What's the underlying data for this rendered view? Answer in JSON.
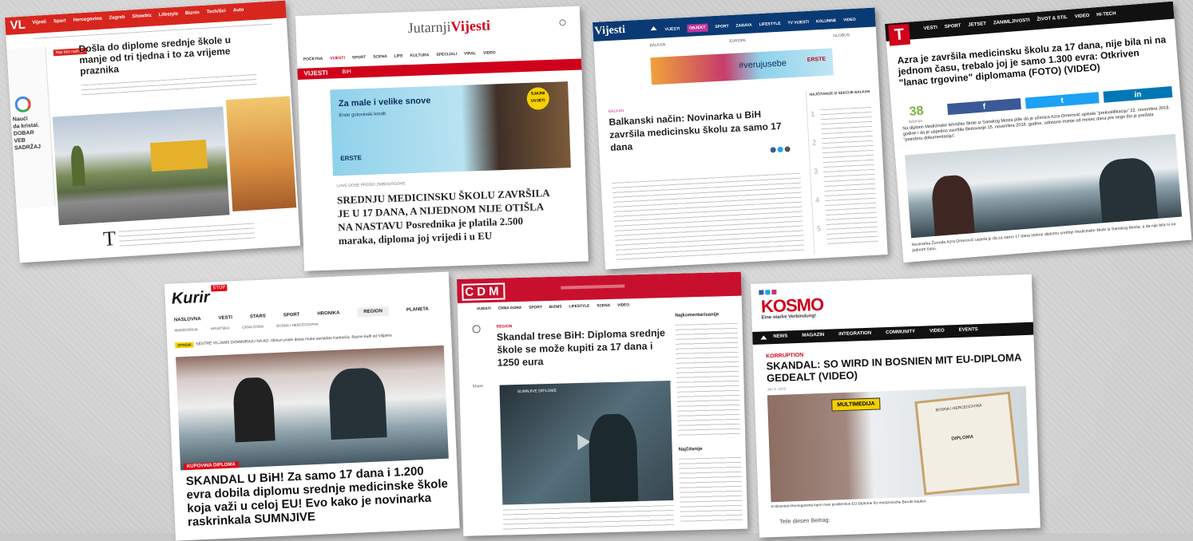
{
  "colors": {
    "vl_red": "#d7261e",
    "jutarnji_red": "#d0021b",
    "vijesti_blue": "#0a3a74",
    "telegraf_red": "#d0021b",
    "kurir_red": "#e30613",
    "cdm_red": "#c8102e",
    "kosmo_red": "#d0021b"
  },
  "vl": {
    "logo": "VL",
    "nav": [
      "Vijesti",
      "Sport",
      "Hercegovina",
      "Zagreb",
      "Showbiz",
      "Lifestyle",
      "Biznis",
      "Tech/Sci",
      "Auto"
    ],
    "tag": "Nije bez razloga",
    "headline": "Došla do diplome srednje škole u manje od tri tjedna i to za vrijeme praznika",
    "ad_lines": [
      "Naući",
      "da kristal.",
      "DOBAR",
      "VEB",
      "SADRŽAJ"
    ],
    "drop": "T"
  },
  "jutarnji": {
    "logo_a": "Jutarnji",
    "logo_b": "Vijesti",
    "nav": [
      "POČETNA",
      "VIJESTI",
      "SPORT",
      "SCENA",
      "LIFE",
      "KULTURA",
      "SPECIJALI",
      "VIRAL",
      "VIDEO"
    ],
    "section": "VIJESTI",
    "sub": "BiH",
    "ad_title": "Za male i velike snove",
    "ad_text": "Erste gotovinski kredit",
    "ad_brand": "ERSTE",
    "ad_badge": "SJAJNI UVJETI",
    "kicker": "LOVE DOSE PRODO ZMBOURGOVE",
    "headline": "SREDNJU MEDICINSKU ŠKOLU ZAVRŠILA JE U 17 DANA, A NIJEDNOM NIJE OTIŠLA NA NASTAVU Posrednika je platila 2.500 maraka, diploma joj vrijedi i u EU"
  },
  "vijesti": {
    "logo": "Vijesti",
    "nav": [
      "VIJESTI",
      "OBJEKT",
      "SPORT",
      "ZABAVA",
      "LIFESTYLE",
      "TV VIJESTI",
      "KOLUMNE",
      "VIDEO"
    ],
    "sub_left": "BALKAN",
    "sub_mid": "EVROPA",
    "sub_right": "GLOBUS",
    "ad": "#verujusebe",
    "ad_brand": "ERSTE",
    "kicker": "BALKAN",
    "headline": "Balkanski način: Novinarka u BiH završila medicinsku školu za samo 17 dana",
    "side_title": "NAJČITANIJE IZ SEKCIJE BALKAN",
    "side_nums": [
      "1",
      "2",
      "3",
      "4",
      "5"
    ]
  },
  "telegraf": {
    "logo": "T",
    "nav": [
      "VESTI",
      "SPORT",
      "JETSET",
      "ZANIMLJIVOSTI",
      "ŽIVOT & STIL",
      "VIDEO",
      "HI-TECH"
    ],
    "headline": "Azra je završila medicinsku školu za 17 dana, nije bila ni na jednom času, trebalo joj je samo 1.300 evra: Otkriven \"lanac trgovine\" diplomama (FOTO) (VIDEO)",
    "share_count": "38",
    "share_label": "deljenja",
    "fb": "f",
    "tw": "t",
    "li": "in",
    "body": "Na diplomi Medicinske tehničke škole iz Sanskog Mosta piše da je učenica Azra Omerović upisala \"prekvalifikaciju\" 22. novembra 2018. godine i da je uspešno završila školovanje 15. novembra 2018. godine, odnosno manje od mesec dana pre nego što je predata \"potrebnu dokumentaciju\".",
    "caption": "Novinarka Žurnala Azra Omerović uspela je da za samo 17 dana stekne diplomu srednje medicinske škole iz Sanskog Mosta, a da nije bila ni na jednom času."
  },
  "kurir": {
    "logo": "Kurir",
    "logo_tag": "STOP",
    "nav": [
      "NASLOVNA",
      "VESTI",
      "STARS",
      "SPORT",
      "HRONIKA",
      "REGION",
      "PLANETA"
    ],
    "sub": [
      "MAKEDONIJA",
      "HRVATSKA",
      "CRNA GORA",
      "BOSNA I HERCEGOVINA"
    ],
    "ticker_tag": "SPREMI",
    "ticker": "SESTRE VILJAMS DOMINIRAJU NA AO: Ištinuri posle dosta muke savladao Karlovića. Razmi kuđi od Vilijams",
    "photo_tag": "KUPOVINA DIPLOMA",
    "headline": "SKANDAL U BiH! Za samo 17 dana i 1.200 evra dobila diplomu srednje medicinske škole koja važi u celoj EU! Evo kako je novinarka raskrinkala SUMNJIVE"
  },
  "cdm": {
    "logo": "CDM",
    "nav": [
      "VIJESTI",
      "CRNA GORA",
      "SPORT",
      "BIZNIS",
      "LIFESTYLE",
      "SCENA",
      "VIDEO"
    ],
    "share": "Share",
    "kicker": "REGION",
    "headline": "Skandal trese BiH: Diploma srednje škole se može kupiti za 17 dana i 1250 eura",
    "video_title": "SUMNJIVE DIPLOME",
    "side_title": "Najkomentarisanije",
    "side_title2": "Najčitanije"
  },
  "kosmo": {
    "logo": "KOSMO",
    "tagline": "Eine starke Verbindung!",
    "nav": [
      "NEWS",
      "MAGAZIN",
      "INTEGRATION",
      "COMMUNITY",
      "VIDEO",
      "EVENTS"
    ],
    "kicker": "KORRUPTION",
    "headline": "SKANDAL: SO WIRD IN BOSNIEN MIT EU-DIPLOMA GEDEALT (VIDEO)",
    "date": "Jan 4, 2019",
    "sign": "MULTIMEDIJA",
    "doc": "BOSNA I HERCEGOVINA",
    "doc2": "DIPLOMA",
    "caption": "In Bosnien-Herzegowina kann man problemlos EU-Diplome für medizinische Berufe kaufen.",
    "footer": "Teile diesen Beitrag:"
  }
}
